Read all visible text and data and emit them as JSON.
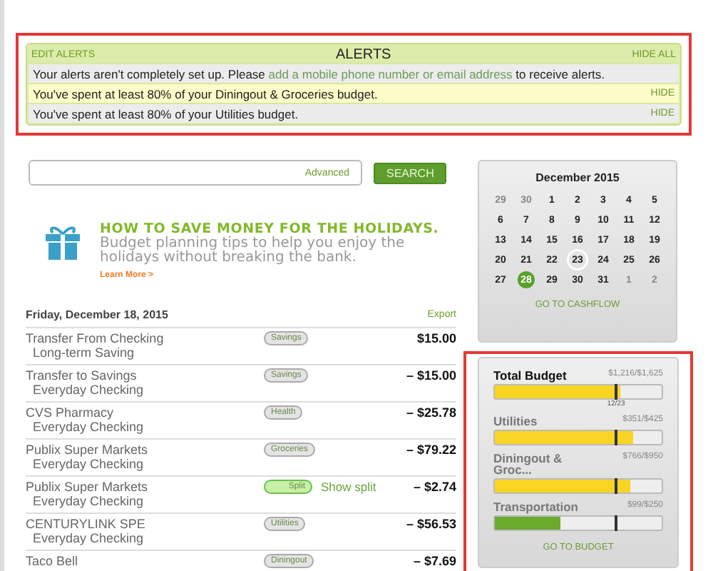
{
  "alerts": {
    "edit_label": "EDIT ALERTS",
    "title": "ALERTS",
    "hide_all_label": "HIDE ALL",
    "items": [
      {
        "kind": "setup",
        "text_before": "Your alerts aren't completely set up. Please ",
        "link": "add a mobile phone number or email address",
        "text_after": " to receive alerts.",
        "highlighted": false
      },
      {
        "kind": "budget",
        "text": "You've spent at least 80% of your Diningout & Groceries budget.",
        "hide_label": "HIDE",
        "highlighted": true
      },
      {
        "kind": "budget",
        "text": "You've spent at least 80% of your Utilities budget.",
        "hide_label": "HIDE",
        "highlighted": false
      }
    ]
  },
  "search": {
    "advanced_label": "Advanced",
    "button": "SEARCH"
  },
  "promo": {
    "headline": "HOW TO SAVE MONEY FOR THE HOLIDAYS.",
    "body": "Budget planning tips to help you enjoy the holidays without breaking the bank.",
    "link": "Learn More >"
  },
  "transactions": {
    "date": "Friday, December 18, 2015",
    "export_label": "Export",
    "rows": [
      {
        "name": "Transfer From Checking",
        "account": "Long-term Saving",
        "kind": "category",
        "category": "Savings",
        "amount": "$15.00"
      },
      {
        "name": "Transfer to Savings",
        "account": "Everyday Checking",
        "kind": "category",
        "category": "Savings",
        "amount": "– $15.00"
      },
      {
        "name": "CVS Pharmacy",
        "account": "Everyday Checking",
        "kind": "category",
        "category": "Health",
        "amount": "– $25.78"
      },
      {
        "name": "Publix Super Markets",
        "account": "Everyday Checking",
        "kind": "category",
        "category": "Groceries",
        "amount": "– $79.22"
      },
      {
        "name": "Publix Super Markets",
        "account": "Everyday Checking",
        "kind": "split",
        "category": "Split",
        "split_link": "Show split",
        "amount": "– $2.74"
      },
      {
        "name": "CENTURYLINK SPE",
        "account": "Everyday Checking",
        "kind": "category",
        "category": "Utilities",
        "amount": "– $56.53"
      },
      {
        "name": "Taco Bell",
        "account": "",
        "kind": "category",
        "category": "Diningout",
        "amount": "– $7.69"
      }
    ]
  },
  "calendar": {
    "title": "December 2015",
    "link": "GO TO CASHFLOW",
    "days": [
      {
        "label": "29",
        "muted": true,
        "selected": false,
        "circled": false
      },
      {
        "label": "30",
        "muted": true,
        "selected": false,
        "circled": false
      },
      {
        "label": "1",
        "muted": false,
        "selected": false,
        "circled": false
      },
      {
        "label": "2",
        "muted": false,
        "selected": false,
        "circled": false
      },
      {
        "label": "3",
        "muted": false,
        "selected": false,
        "circled": false
      },
      {
        "label": "4",
        "muted": false,
        "selected": false,
        "circled": false
      },
      {
        "label": "5",
        "muted": false,
        "selected": false,
        "circled": false
      },
      {
        "label": "6",
        "muted": false,
        "selected": false,
        "circled": false
      },
      {
        "label": "7",
        "muted": false,
        "selected": false,
        "circled": false
      },
      {
        "label": "8",
        "muted": false,
        "selected": false,
        "circled": false
      },
      {
        "label": "9",
        "muted": false,
        "selected": false,
        "circled": false
      },
      {
        "label": "10",
        "muted": false,
        "selected": false,
        "circled": false
      },
      {
        "label": "11",
        "muted": false,
        "selected": false,
        "circled": false
      },
      {
        "label": "12",
        "muted": false,
        "selected": false,
        "circled": false
      },
      {
        "label": "13",
        "muted": false,
        "selected": false,
        "circled": false
      },
      {
        "label": "14",
        "muted": false,
        "selected": false,
        "circled": false
      },
      {
        "label": "15",
        "muted": false,
        "selected": false,
        "circled": false
      },
      {
        "label": "16",
        "muted": false,
        "selected": false,
        "circled": false
      },
      {
        "label": "17",
        "muted": false,
        "selected": false,
        "circled": false
      },
      {
        "label": "18",
        "muted": false,
        "selected": false,
        "circled": false
      },
      {
        "label": "19",
        "muted": false,
        "selected": false,
        "circled": false
      },
      {
        "label": "20",
        "muted": false,
        "selected": false,
        "circled": false
      },
      {
        "label": "21",
        "muted": false,
        "selected": false,
        "circled": false
      },
      {
        "label": "22",
        "muted": false,
        "selected": false,
        "circled": false
      },
      {
        "label": "23",
        "muted": false,
        "selected": false,
        "circled": true
      },
      {
        "label": "24",
        "muted": false,
        "selected": false,
        "circled": false
      },
      {
        "label": "25",
        "muted": false,
        "selected": false,
        "circled": false
      },
      {
        "label": "26",
        "muted": false,
        "selected": false,
        "circled": false
      },
      {
        "label": "27",
        "muted": false,
        "selected": false,
        "circled": false
      },
      {
        "label": "28",
        "muted": false,
        "selected": true,
        "circled": false
      },
      {
        "label": "29",
        "muted": false,
        "selected": false,
        "circled": false
      },
      {
        "label": "30",
        "muted": false,
        "selected": false,
        "circled": false
      },
      {
        "label": "31",
        "muted": false,
        "selected": false,
        "circled": false
      },
      {
        "label": "1",
        "muted": true,
        "selected": false,
        "circled": false
      },
      {
        "label": "2",
        "muted": true,
        "selected": false,
        "circled": false
      }
    ]
  },
  "budget": {
    "link": "GO TO BUDGET",
    "marker_label": "12/23",
    "items": [
      {
        "name": "Total Budget",
        "amount": "$1,216/$1,625",
        "level": 0.75,
        "color": "#f9d423",
        "emphasis": true
      },
      {
        "name": "Utilities",
        "amount": "$351/$425",
        "level": 0.83,
        "color": "#f9d423",
        "emphasis": false
      },
      {
        "name": "Diningout & Groc...",
        "amount": "$766/$950",
        "level": 0.81,
        "color": "#f9d423",
        "emphasis": false
      },
      {
        "name": "Transportation",
        "amount": "$99/$250",
        "level": 0.39,
        "color": "#6aab2e",
        "emphasis": false
      }
    ]
  }
}
